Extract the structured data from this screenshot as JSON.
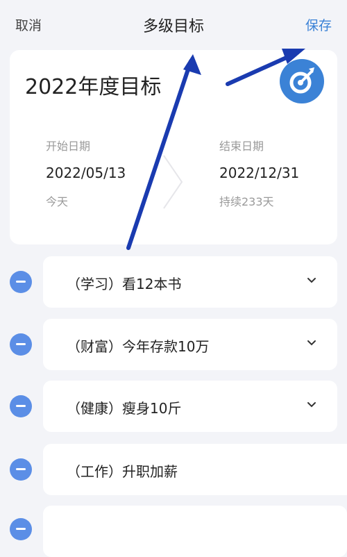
{
  "header": {
    "cancel_label": "取消",
    "title": "多级目标",
    "save_label": "保存"
  },
  "card": {
    "title": "2022年度目标",
    "icon": "target-icon",
    "start": {
      "label": "开始日期",
      "date": "2022/05/13",
      "note": "今天"
    },
    "end": {
      "label": "结束日期",
      "date": "2022/12/31",
      "note": "持续233天"
    }
  },
  "goals": [
    {
      "text": "（学习）看12本书"
    },
    {
      "text": "（财富）今年存款10万"
    },
    {
      "text": "（健康）瘦身10斤"
    },
    {
      "text": "（工作）升职加薪"
    }
  ],
  "colors": {
    "accent": "#3b82d6",
    "minus": "#5b8ee6",
    "annotation_arrow": "#1a3bb0"
  }
}
